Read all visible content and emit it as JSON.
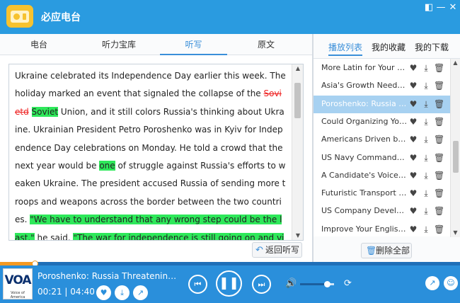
{
  "app": {
    "title": "必应电台"
  },
  "left_tabs": [
    {
      "label": "电台"
    },
    {
      "label": "听力宝库"
    },
    {
      "label": "听写"
    },
    {
      "label": "原文"
    }
  ],
  "dictation": {
    "seg_01": "Ukraine celebrated its Independence Day earlier this week. The holiday marked an event that signaled the collapse of the ",
    "wrong_word": "Sovietd",
    "seg_02": " ",
    "correct_word_1": "Soviet",
    "seg_03": " Union, and it still colors Russia's thinking about Ukraine. Ukrainian President Petro Poroshenko was in Kyiv for Independence Day celebrations on Monday. He told a crowd that the next year would be ",
    "correct_word_2": "one",
    "seg_04": " of struggle against Russia's efforts to weaken Ukraine. The president accused Russia of sending more troops and weapons across the border between the two countries. ",
    "correct_passage_1": "\"We have to understand that any wrong step could be the last,\"",
    "seg_05": " he said. ",
    "correct_passage_2": "\"The war for independence is still going on and victory is possible only through combined efforts of defense, diplomatic pressure and political responsibility"
  },
  "back_button": {
    "label": "返回听写"
  },
  "right_tabs": [
    {
      "label": "播放列表"
    },
    {
      "label": "我的收藏"
    },
    {
      "label": "我的下载"
    }
  ],
  "playlist": [
    {
      "title": "More Latin for Your Everyday English"
    },
    {
      "title": "Asia's Growth Needs to Be Inclusive"
    },
    {
      "title": "Poroshenko: Russia Threatening Ukraine",
      "selected": true
    },
    {
      "title": "Could Organizing Your Life Make You Happier"
    },
    {
      "title": "Americans Driven by 'Wanderlust'"
    },
    {
      "title": "US Navy Commander Concerned"
    },
    {
      "title": "A Candidate's Voice Matters"
    },
    {
      "title": "Futuristic Transport Systems"
    },
    {
      "title": "US Company Developing New Technology"
    },
    {
      "title": "Improve Your English Writing"
    }
  ],
  "delete_all": {
    "label": "删除全部"
  },
  "player": {
    "now_playing": "Poroshenko: Russia Threatening Ukraine",
    "current_time": "00:21",
    "separator": "|",
    "total_time": "04:40",
    "progress_fraction": 0.075,
    "volume_fraction": 0.8,
    "logo_text": "VOA",
    "logo_sub": "Voice of America"
  },
  "colors": {
    "titlebar": "#2a9be0",
    "accent": "#3a8fd9",
    "highlight": "#2ee85a",
    "error": "#e22222",
    "progress": "#f59a23"
  }
}
